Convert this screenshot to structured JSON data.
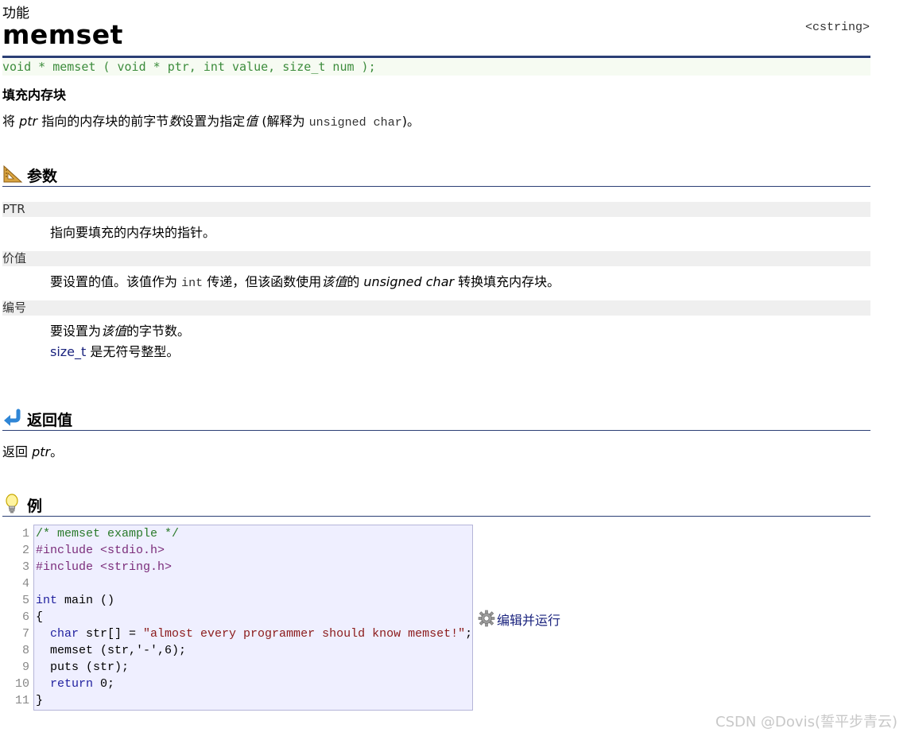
{
  "header": {
    "category": "功能",
    "title": "memset",
    "library": "<cstring>"
  },
  "prototype": "void * memset ( void * ptr, int value, size_t num );",
  "short_description": "填充内存块",
  "description": {
    "p1": "将 ",
    "ptr": "ptr",
    "p2": " 指向的内存块的前字节",
    "num": "数",
    "p3": "设置为指定",
    "value": "值",
    "p4": " (解释为 ",
    "unsigned_char": "unsigned char",
    "p5": ")。"
  },
  "sections": {
    "params_title": "参数",
    "return_title": "返回值",
    "example_title": "例"
  },
  "params": [
    {
      "name": "PTR",
      "text": "指向要填充的内存块的指针。"
    },
    {
      "name": "价值",
      "t1": "要设置的值。该值作为 ",
      "int": "int",
      "t2": " 传递，但该函数使用",
      "value_em": "该值",
      "t3": "的 ",
      "unsigned_char_em": "unsigned char",
      "t4": " 转换填充内存块。"
    },
    {
      "name": "编号",
      "t1": "要设置为",
      "value_em": "该值",
      "t2": "的字节数。",
      "size_t": "size_t",
      "t3": " 是无符号整型。"
    }
  ],
  "return_value": {
    "t1": "返回 ",
    "ptr": "ptr",
    "t2": "。"
  },
  "code": {
    "line_numbers": [
      "1",
      "2",
      "3",
      "4",
      "5",
      "6",
      "7",
      "8",
      "9",
      "10",
      "11"
    ],
    "l1": "/* memset example */",
    "l2": "#include <stdio.h>",
    "l3": "#include <string.h>",
    "l5_kw": "int",
    "l5_rest": " main ()",
    "l6": "{",
    "l7_kw": "  char",
    "l7_mid": " str[] = ",
    "l7_str": "\"almost every programmer should know memset!\"",
    "l7_end": ";",
    "l8": "  memset (str,'-',6);",
    "l9": "  puts (str);",
    "l10_kw": "  return",
    "l10_rest": " 0;",
    "l11": "}"
  },
  "run_button_label": "编辑并运行",
  "watermark": "CSDN @Dovis(誓平步青云)",
  "icons": {
    "params": "set-square-icon",
    "return": "return-arrow-icon",
    "example": "lightbulb-icon",
    "run": "gear-icon"
  }
}
